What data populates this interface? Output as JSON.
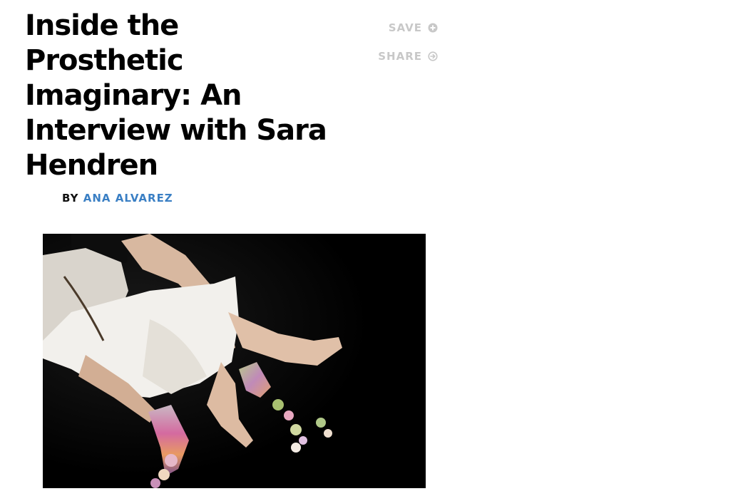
{
  "article": {
    "headline_lines": [
      "Inside the",
      "Prosthetic",
      "Imaginary: An",
      "Interview with Sara",
      "Hendren"
    ],
    "byline_prefix": "BY",
    "author": "ANA ALVAREZ"
  },
  "actions": {
    "save_label": "SAVE",
    "save_icon": "plus-circle-icon",
    "share_label": "SHARE",
    "share_icon": "arrow-circle-icon"
  },
  "photo": {
    "subject": "seated woman in white dress with knitted prosthetic extensions"
  },
  "colors": {
    "author_link": "#3a7fc4",
    "action_gray": "#c8c8c8",
    "photo_background": "#000000"
  }
}
